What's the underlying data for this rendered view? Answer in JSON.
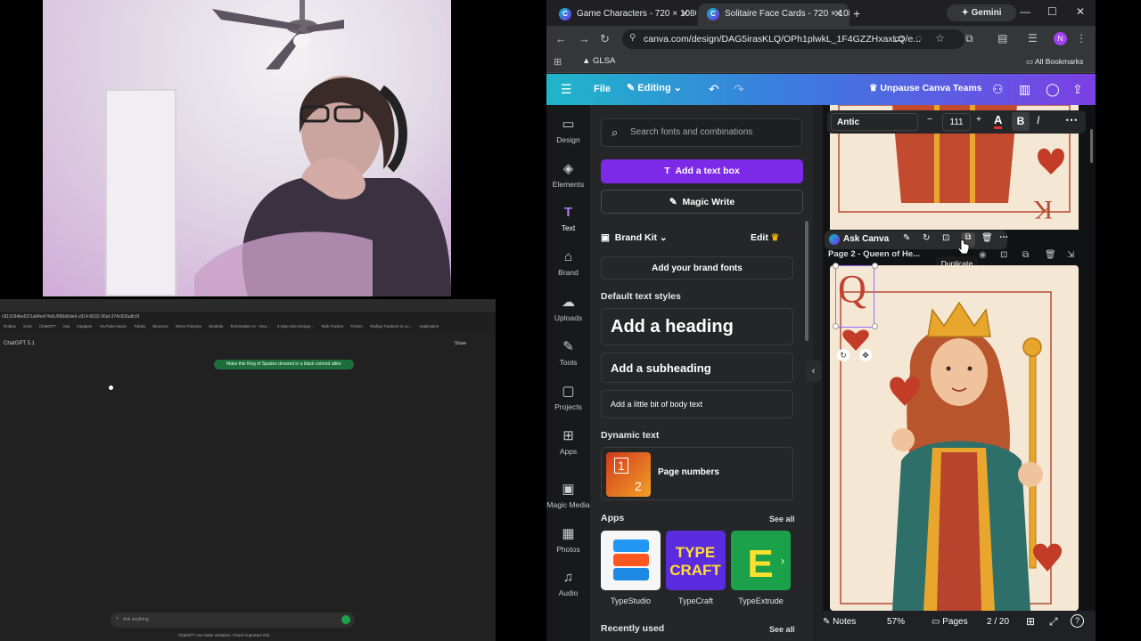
{
  "chatgpt": {
    "address": "c819184bef201a84ed74d/c/686d6de6-c814-8032-95af-374c826a8c0f",
    "bookmarks": [
      "Roblox",
      "Grok",
      "ChatGPT",
      "Gwi",
      "Gadgets",
      "YouTube Music",
      "Tubely",
      "Bloxxers",
      "GEUs Polymer",
      "Modelia",
      "Techmaster AI - Geo...",
      "3 Step Site Design...",
      "Task Tracker",
      "Ficken",
      "Tooling Trackers in Lo...",
      "Application"
    ],
    "model": "ChatGPT 5.1",
    "share": "Share",
    "message": "Make this King of Spades dressed in a black colored attire",
    "composer_placeholder": "Ask anything",
    "footer": "ChatGPT can make mistakes. Check important info."
  },
  "browser": {
    "tabs": [
      {
        "title": "Game Characters - 720 × 1080px",
        "active": false
      },
      {
        "title": "Solitaire Face Cards - 720 × 1080px",
        "active": true
      }
    ],
    "gemini": "Gemini",
    "url": "canva.com/design/DAG5irasKLQ/OPh1plwkL_1F4GZZHxaxLQ/e...",
    "bookmark_glsa": "GLSA",
    "all_bookmarks": "All Bookmarks"
  },
  "canva": {
    "file": "File",
    "editing": "Editing",
    "unpause": "Unpause Canva Teams",
    "rail": [
      {
        "label": "Design",
        "icon": "▭"
      },
      {
        "label": "Elements",
        "icon": "◈"
      },
      {
        "label": "Text",
        "icon": "T"
      },
      {
        "label": "Brand",
        "icon": "⌂"
      },
      {
        "label": "Uploads",
        "icon": "☁"
      },
      {
        "label": "Tools",
        "icon": "✎"
      },
      {
        "label": "Projects",
        "icon": "▢"
      },
      {
        "label": "Apps",
        "icon": "⊞"
      },
      {
        "label": "Magic Media",
        "icon": "▣"
      },
      {
        "label": "Photos",
        "icon": "▦"
      },
      {
        "label": "Audio",
        "icon": "♫"
      }
    ],
    "search_placeholder": "Search fonts and combinations",
    "add_text_box": "Add a text box",
    "magic_write": "Magic Write",
    "brand_kit": "Brand Kit",
    "edit": "Edit",
    "add_brand_fonts": "Add your brand fonts",
    "default_styles": "Default text styles",
    "heading": "Add a heading",
    "subheading": "Add a subheading",
    "body": "Add a little bit of body text",
    "dynamic_text": "Dynamic text",
    "page_numbers": "Page numbers",
    "apps": "Apps",
    "see_all": "See all",
    "app_list": [
      "TypeStudio",
      "TypeCraft",
      "TypeExtrude"
    ],
    "recently_used": "Recently used",
    "font_name": "Antic",
    "font_size": "111",
    "ask_canva": "Ask Canva",
    "tooltip": "Duplicate",
    "page_label": "Page 2 - Queen of He...",
    "card_letter": "Q",
    "notes": "Notes",
    "zoom": "57%",
    "pages": "Pages",
    "page_count": "2 / 20",
    "accent": "#7d2ae8"
  }
}
